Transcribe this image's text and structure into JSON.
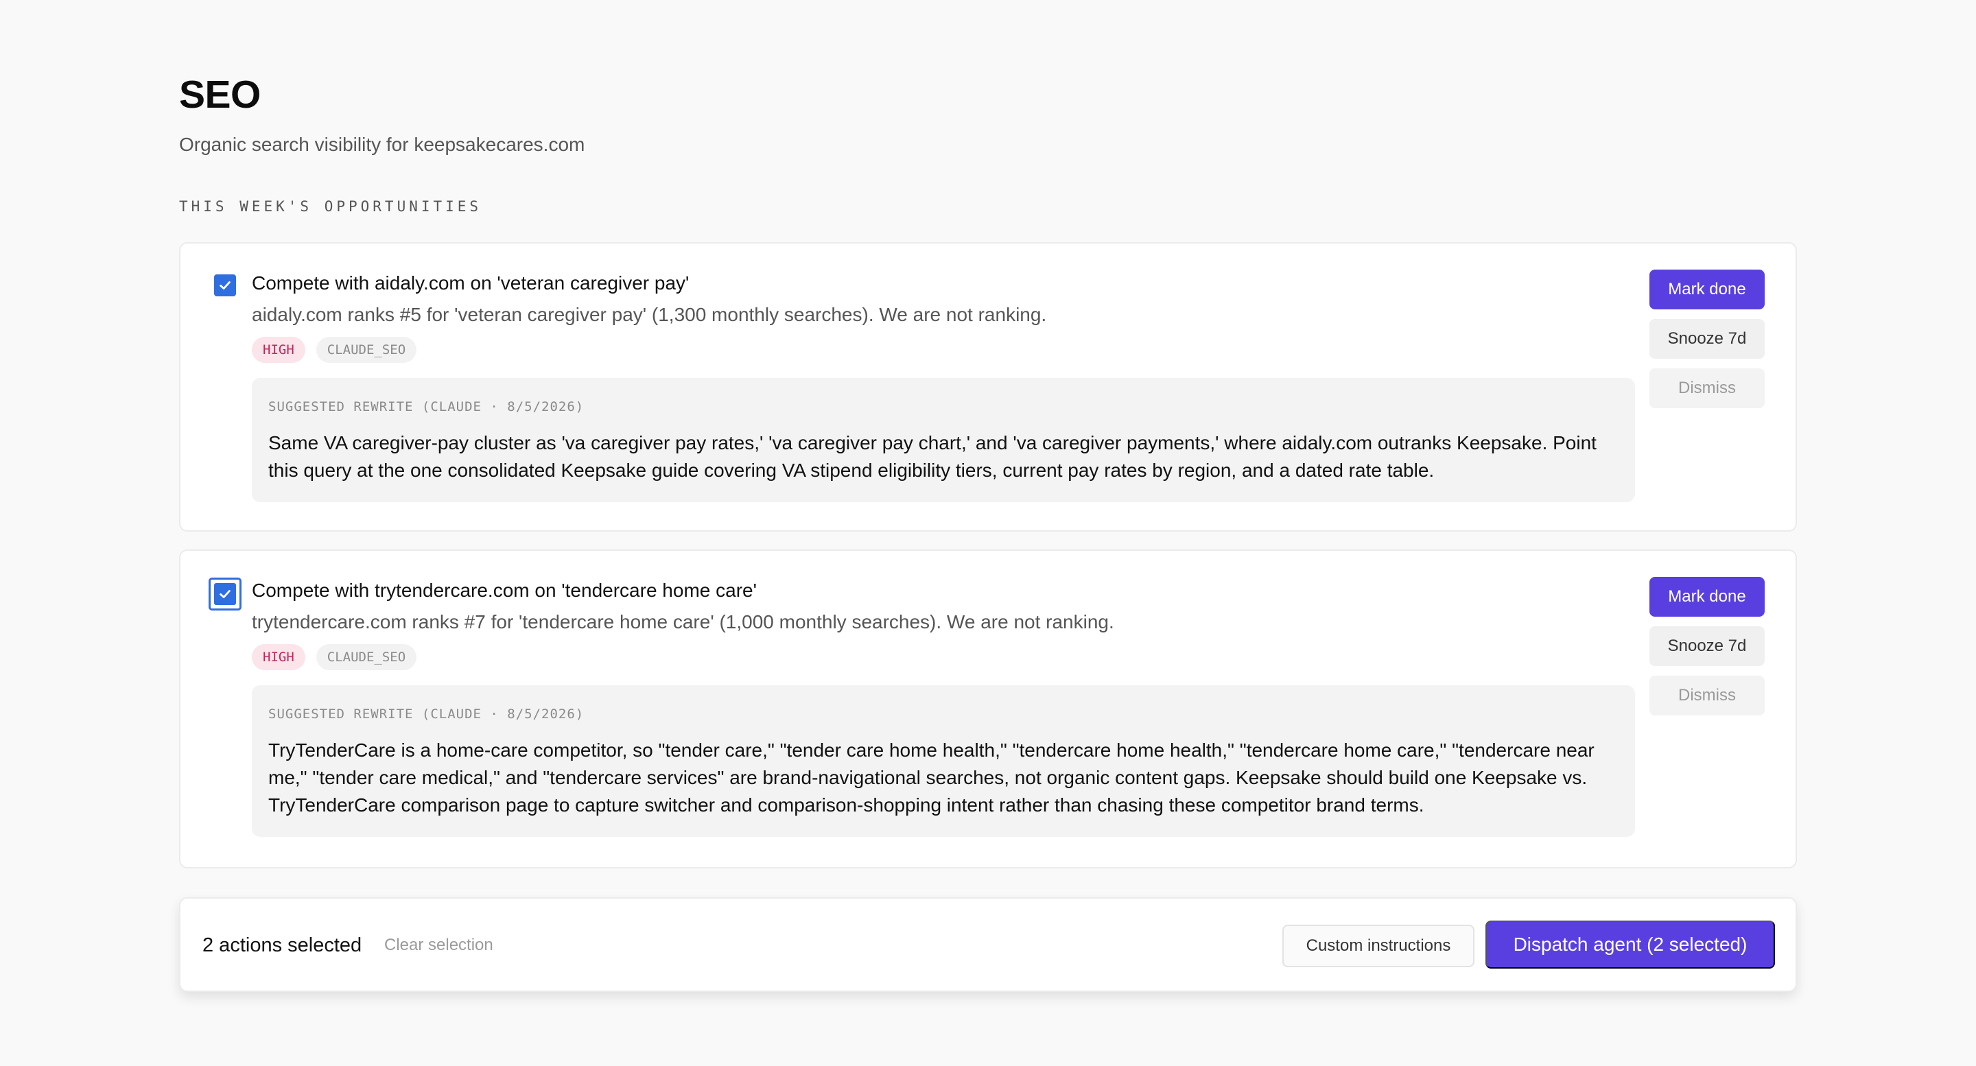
{
  "header": {
    "title": "SEO",
    "subtitle": "Organic search visibility for keepsakecares.com"
  },
  "section_label": "THIS WEEK'S OPPORTUNITIES",
  "opportunities": [
    {
      "checked": true,
      "title": "Compete with aidaly.com on 'veteran caregiver pay'",
      "description": "aidaly.com ranks #5 for 'veteran caregiver pay' (1,300 monthly searches). We are not ranking.",
      "priority": "HIGH",
      "source": "CLAUDE_SEO",
      "rewrite_label": "SUGGESTED REWRITE (CLAUDE · 8/5/2026)",
      "rewrite_text": "Same VA caregiver-pay cluster as 'va caregiver pay rates,' 'va caregiver pay chart,' and 'va caregiver payments,' where aidaly.com outranks Keepsake. Point this query at the one consolidated Keepsake guide covering VA stipend eligibility tiers, current pay rates by region, and a dated rate table.",
      "actions": {
        "mark_done": "Mark done",
        "snooze": "Snooze 7d",
        "dismiss": "Dismiss"
      }
    },
    {
      "checked": true,
      "title": "Compete with trytendercare.com on 'tendercare home care'",
      "description": "trytendercare.com ranks #7 for 'tendercare home care' (1,000 monthly searches). We are not ranking.",
      "priority": "HIGH",
      "source": "CLAUDE_SEO",
      "rewrite_label": "SUGGESTED REWRITE (CLAUDE · 8/5/2026)",
      "rewrite_text": "TryTenderCare is a home-care competitor, so \"tender care,\" \"tender care home health,\" \"tendercare home health,\" \"tendercare home care,\" \"tendercare near me,\" \"tender care medical,\" and \"tendercare services\" are brand-navigational searches, not organic content gaps. Keepsake should build one Keepsake vs. TryTenderCare comparison page to capture switcher and comparison-shopping intent rather than chasing these competitor brand terms.",
      "actions": {
        "mark_done": "Mark done",
        "snooze": "Snooze 7d",
        "dismiss": "Dismiss"
      }
    }
  ],
  "action_bar": {
    "selected_text": "2 actions selected",
    "clear_label": "Clear selection",
    "custom_label": "Custom instructions",
    "dispatch_label": "Dispatch agent (2 selected)"
  },
  "colors": {
    "accent": "#5a3fe0",
    "checkbox": "#2f6ee0",
    "high_badge_bg": "#fbe4ea",
    "high_badge_text": "#c2255c"
  }
}
